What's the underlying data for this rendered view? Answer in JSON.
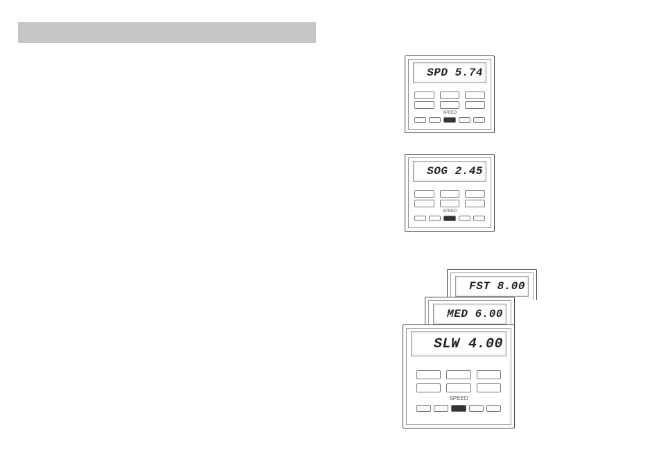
{
  "header": {
    "title": ""
  },
  "device_spd": {
    "label": "SPD",
    "value": "5.74"
  },
  "device_sog": {
    "label": "SOG",
    "value": "2.45"
  },
  "stack": {
    "fst": {
      "label": "FST",
      "value": "8.00"
    },
    "med": {
      "label": "MED",
      "value": "6.00"
    },
    "slw": {
      "label": "SLW",
      "value": "4.00"
    }
  },
  "labels": {
    "speed": "SPEED"
  }
}
